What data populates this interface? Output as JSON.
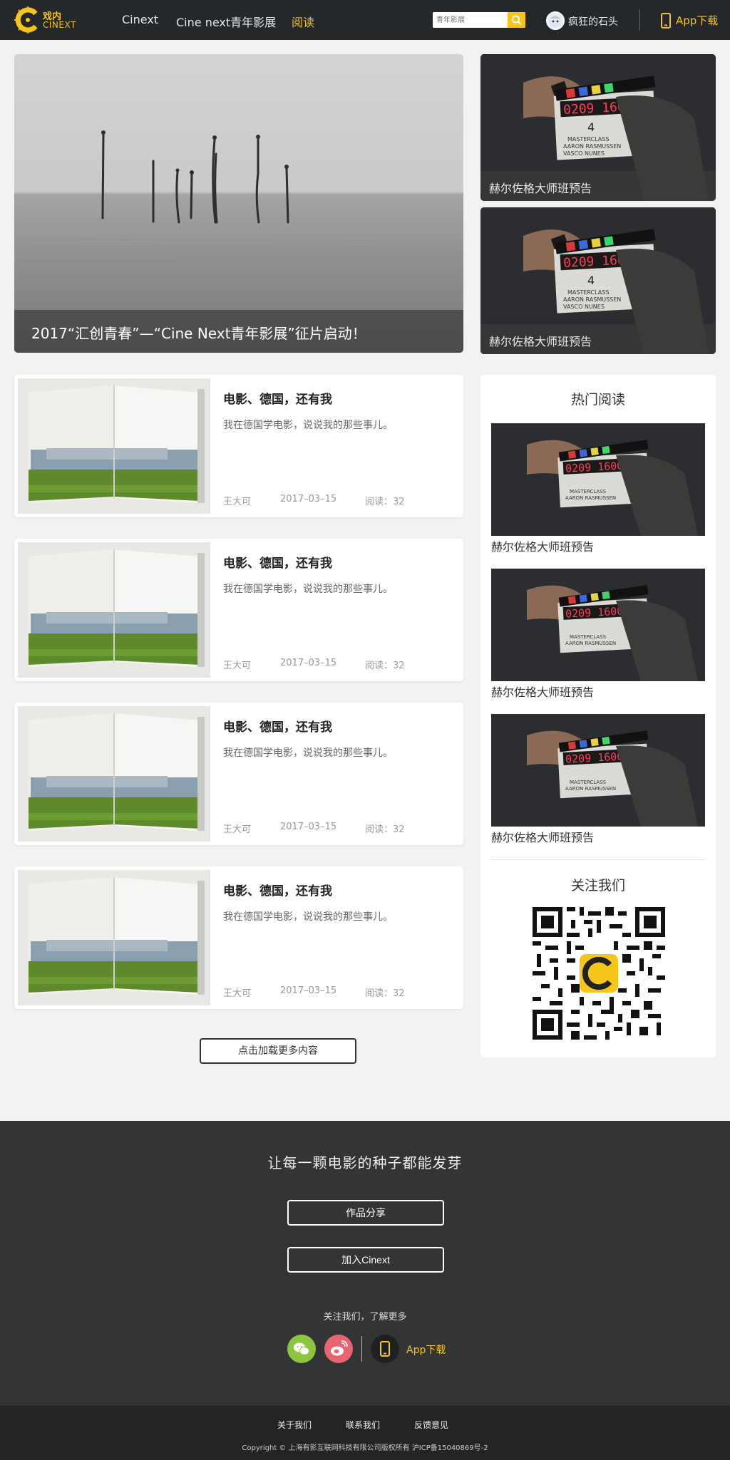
{
  "brand": {
    "logo_cn": "戏内",
    "logo_en": "CINEXT",
    "accent": "#f5c518"
  },
  "nav": {
    "items": [
      {
        "label": "Cinext"
      },
      {
        "label": "Cine next青年影展"
      },
      {
        "label": "阅读"
      }
    ]
  },
  "search": {
    "placeholder": "青年影展",
    "icon": "search-icon"
  },
  "user": {
    "name": "疯狂的石头"
  },
  "app": {
    "label": "App下载",
    "icon": "phone-icon"
  },
  "hero": {
    "caption": "2017“汇创青春”—“Cine Next青年影展”征片启动！"
  },
  "side_cards": [
    {
      "caption": "赫尔佐格大师班预告"
    },
    {
      "caption": "赫尔佐格大师班预告"
    }
  ],
  "articles": [
    {
      "title": "电影、德国，还有我",
      "summary": "我在德国学电影，说说我的那些事儿。",
      "author": "王大可",
      "date": "2017–03–15",
      "reads": "阅读：32"
    },
    {
      "title": "电影、德国，还有我",
      "summary": "我在德国学电影，说说我的那些事儿。",
      "author": "王大可",
      "date": "2017–03–15",
      "reads": "阅读：32"
    },
    {
      "title": "电影、德国，还有我",
      "summary": "我在德国学电影，说说我的那些事儿。",
      "author": "王大可",
      "date": "2017–03–15",
      "reads": "阅读：32"
    },
    {
      "title": "电影、德国，还有我",
      "summary": "我在德国学电影，说说我的那些事儿。",
      "author": "王大可",
      "date": "2017–03–15",
      "reads": "阅读：32"
    }
  ],
  "load_more": "点击加载更多内容",
  "hot": {
    "title": "热门阅读",
    "items": [
      {
        "label": "赫尔佐格大师班预告"
      },
      {
        "label": "赫尔佐格大师班预告"
      },
      {
        "label": "赫尔佐格大师班预告"
      }
    ]
  },
  "follow": {
    "title": "关注我们"
  },
  "footer": {
    "slogan": "让每一颗电影的种子都能发芽",
    "share_btn": "作品分享",
    "join_btn": "加入Cinext",
    "follow_more": "关注我们，了解更多",
    "social": [
      "wechat-icon",
      "weibo-icon"
    ],
    "app_label": "App下载",
    "links": [
      "关于我们",
      "联系我们",
      "反馈意见"
    ],
    "copyright": "Copyright © 上海有影互联网科技有限公司版权所有 沪ICP备15040869号-2"
  }
}
